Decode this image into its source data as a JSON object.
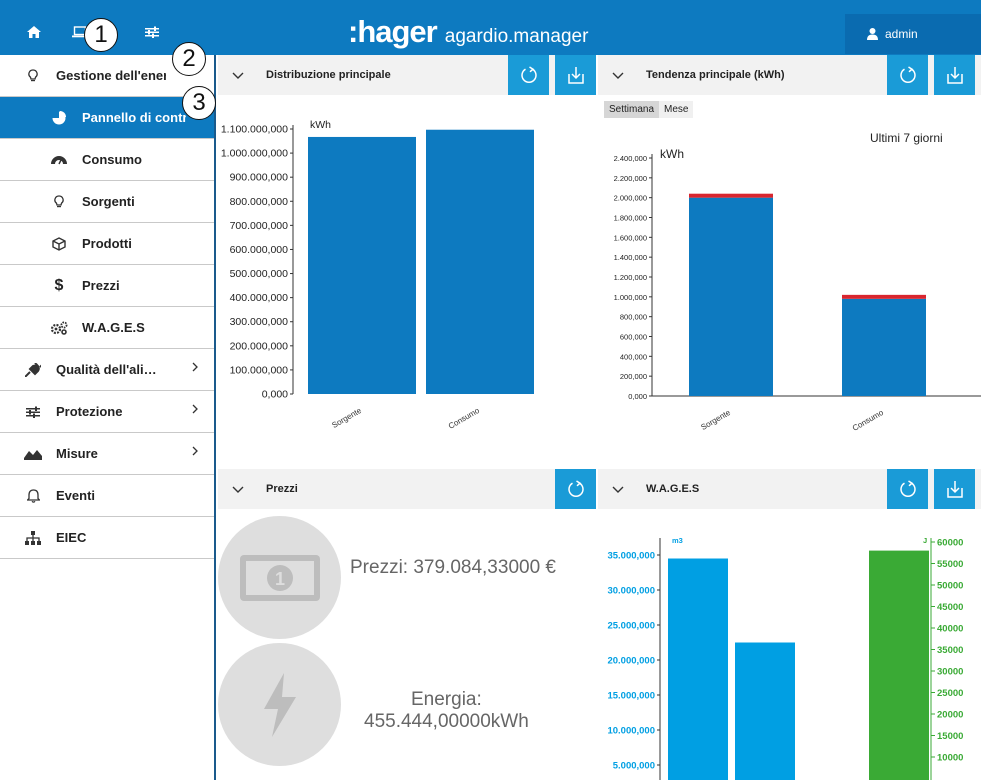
{
  "app": {
    "brand": ":hager",
    "product": "agardio.manager",
    "user": "admin"
  },
  "callouts": [
    "1",
    "2",
    "3"
  ],
  "sidebar": {
    "items": [
      {
        "label": "Gestione dell'energia",
        "icon": "lightbulb-icon",
        "level": "top"
      },
      {
        "label": "Pannello di controllo",
        "icon": "pie-chart-icon",
        "level": "sub",
        "active": true
      },
      {
        "label": "Consumo",
        "icon": "gauge-icon",
        "level": "sub"
      },
      {
        "label": "Sorgenti",
        "icon": "lightbulb-icon",
        "level": "sub"
      },
      {
        "label": "Prodotti",
        "icon": "cube-icon",
        "level": "sub"
      },
      {
        "label": "Prezzi",
        "icon": "dollar-icon",
        "level": "sub"
      },
      {
        "label": "W.A.G.E.S",
        "icon": "cogs-icon",
        "level": "sub"
      },
      {
        "label": "Qualità dell'alimentazione",
        "icon": "plug-icon",
        "level": "top",
        "chevron": true
      },
      {
        "label": "Protezione",
        "icon": "sliders-icon",
        "level": "top",
        "chevron": true
      },
      {
        "label": "Misure",
        "icon": "area-chart-icon",
        "level": "top",
        "chevron": true
      },
      {
        "label": "Eventi",
        "icon": "bell-icon",
        "level": "top"
      },
      {
        "label": "EIEC",
        "icon": "sitemap-icon",
        "level": "top"
      }
    ]
  },
  "panels": {
    "distribuzione": {
      "title": "Distribuzione principale"
    },
    "tendenza": {
      "title": "Tendenza principale (kWh)",
      "toggle_week": "Settimana",
      "toggle_month": "Mese",
      "range_label": "Ultimi 7 giorni"
    },
    "prezzi": {
      "title": "Prezzi",
      "price_text": "Prezzi: 379.084,33000 €",
      "energy_line1": "Energia:",
      "energy_line2": "455.444,00000kWh"
    },
    "wages": {
      "title": "W.A.G.E.S"
    }
  },
  "colors": {
    "header_blue": "#0d7ac0",
    "bar_blue": "#0d7ac0",
    "button_blue": "#1a9bd7",
    "wages_blue": "#009fe3",
    "wages_green": "#3aaa35",
    "stack_red": "#d9262f"
  },
  "chart_data": [
    {
      "type": "bar",
      "id": "distribuzione",
      "categories": [
        "Sorgente",
        "Consumo"
      ],
      "values": [
        1067000000,
        1097000000
      ],
      "ylabel": "kWh",
      "ylim": [
        0,
        1100000000
      ],
      "yticks": [
        "0,000",
        "100.000,000",
        "200.000,000",
        "300.000,000",
        "400.000,000",
        "500.000,000",
        "600.000,000",
        "700.000,000",
        "800.000,000",
        "900.000,000",
        "1.000.000,000",
        "1.100.000,000"
      ]
    },
    {
      "type": "bar",
      "id": "tendenza",
      "stacked": true,
      "categories": [
        "Sorgente",
        "Consumo"
      ],
      "series": [
        {
          "values": [
            2000000,
            980000
          ],
          "color": "#0d7ac0"
        },
        {
          "values": [
            40000,
            40000
          ],
          "color": "#d9262f"
        }
      ],
      "ylabel": "kWh",
      "ylim": [
        0,
        2400000
      ],
      "yticks": [
        "0,000",
        "200,000",
        "400,000",
        "600,000",
        "800,000",
        "1.000,000",
        "1.200,000",
        "1.400,000",
        "1.600,000",
        "1.800,000",
        "2.000,000",
        "2.200,000",
        "2.400,000"
      ]
    },
    {
      "type": "bar",
      "id": "wages",
      "left_axis": {
        "unit": "m3",
        "ticks": [
          "5.000,000",
          "10.000,000",
          "15.000,000",
          "20.000,000",
          "25.000,000",
          "30.000,000",
          "35.000,000"
        ],
        "ylim": [
          0,
          35000000
        ]
      },
      "right_axis": {
        "unit": "J",
        "ticks": [
          "10000",
          "15000",
          "20000",
          "25000",
          "30000",
          "35000",
          "40000",
          "45000",
          "50000",
          "55000",
          "60000"
        ],
        "ylim": [
          0,
          60000
        ]
      },
      "series": [
        {
          "axis": "left",
          "values": [
            34500000,
            22500000
          ],
          "color": "#009fe3"
        },
        {
          "axis": "right",
          "values": [
            58000
          ],
          "color": "#3aaa35"
        }
      ]
    }
  ]
}
